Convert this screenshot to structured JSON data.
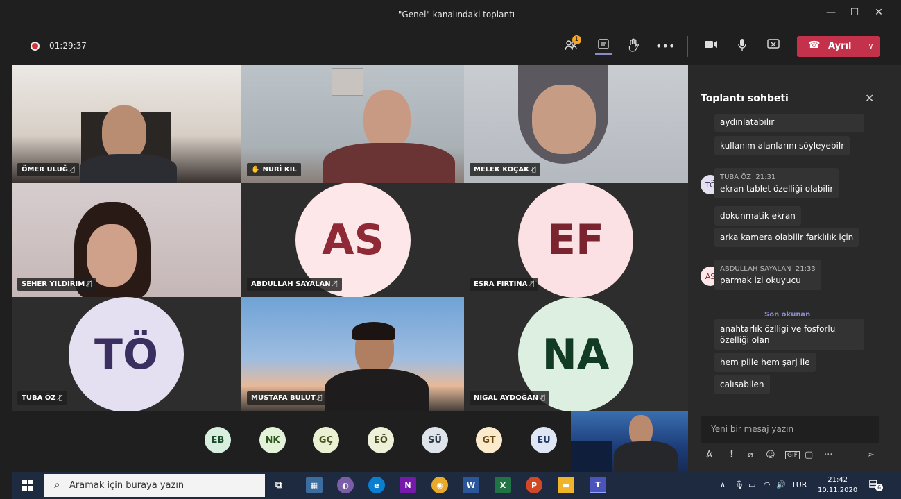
{
  "window": {
    "title": "\"Genel\" kanalındaki toplantı",
    "minimize": "—",
    "maximize": "☐",
    "close": "✕"
  },
  "toolbar": {
    "timer": "01:29:37",
    "participants_badge": "1",
    "leave_label": "Ayrıl"
  },
  "tiles": [
    {
      "name": "ÖMER ULUĞ"
    },
    {
      "name": "NURİ KIL"
    },
    {
      "name": "MELEK KOÇAK"
    },
    {
      "name": "SEHER YILDIRIM"
    },
    {
      "name": "ABDULLAH SAYALAN",
      "initials": "AS"
    },
    {
      "name": "ESRA FIRTINA",
      "initials": "EF"
    },
    {
      "name": "TUBA ÖZ",
      "initials": "TÖ"
    },
    {
      "name": "MUSTAFA BULUT"
    },
    {
      "name": "NİGAL AYDOĞAN",
      "initials": "NA"
    }
  ],
  "participants_bar": [
    "EB",
    "NK",
    "GÇ",
    "EÖ",
    "SÜ",
    "GT",
    "EU"
  ],
  "chat": {
    "title": "Toplantı sohbeti",
    "messages": [
      "aydınlatabılır",
      "kullanım alanlarını söyleyebilr",
      "ekran tablet özelliği olabilir",
      "dokunmatik ekran",
      "arka kamera olabilir farklılık için",
      "parmak izi okuyucu",
      "anahtarlık özlligi ve fosforlu",
      "özelliği olan",
      "hem pille hem şarj ile",
      "calısabilen"
    ],
    "sender1": {
      "initials": "TÖ",
      "name": "TUBA ÖZ",
      "time": "21:31"
    },
    "sender2": {
      "initials": "AS",
      "name": "ABDULLAH SAYALAN",
      "time": "21:33"
    },
    "last_read": "Son okunan",
    "compose_placeholder": "Yeni bir mesaj yazın"
  },
  "taskbar": {
    "search_placeholder": "Aramak için buraya yazın",
    "lang": "TUR",
    "time": "21:42",
    "date": "10.11.2020",
    "notifications": "6"
  },
  "colors": {
    "leave": "#c4314b",
    "accent": "#6264a7",
    "taskbar": "#1e2a40"
  }
}
